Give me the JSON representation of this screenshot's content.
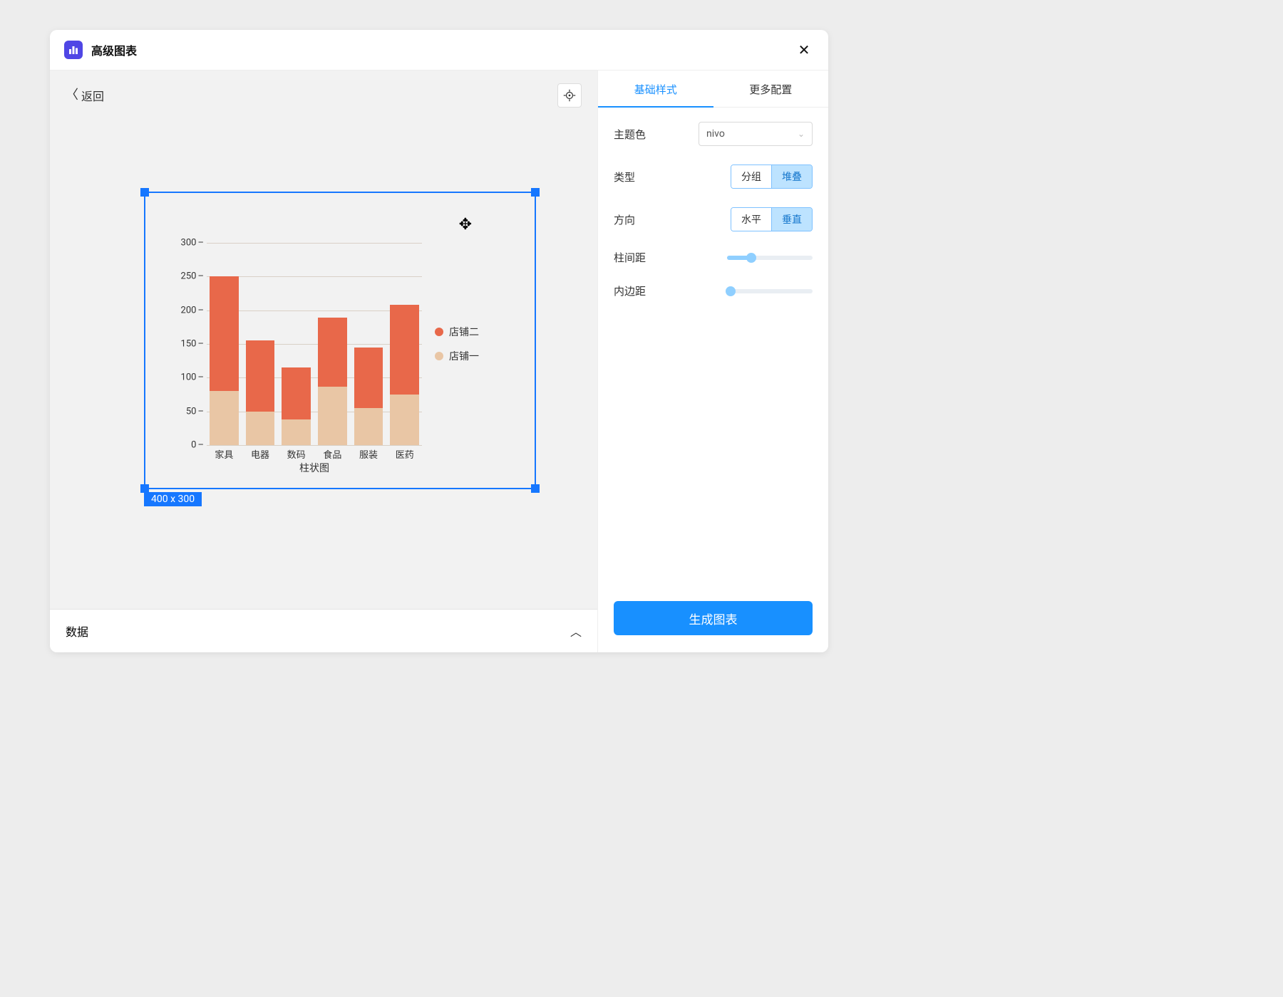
{
  "header": {
    "title": "高级图表",
    "close_label": "✕"
  },
  "canvas": {
    "back_label": "返回",
    "size_tag": "400 x 300"
  },
  "drawer": {
    "label": "数据"
  },
  "tabs": {
    "basic": "基础样式",
    "more": "更多配置"
  },
  "config": {
    "theme_label": "主题色",
    "theme_value": "nivo",
    "type_label": "类型",
    "type_options": {
      "group": "分组",
      "stack": "堆叠"
    },
    "type_selected": "stack",
    "direction_label": "方向",
    "direction_options": {
      "horizontal": "水平",
      "vertical": "垂直"
    },
    "direction_selected": "vertical",
    "gap_label": "柱间距",
    "gap_value_pct": 28,
    "padding_label": "内边距",
    "padding_value_pct": 4
  },
  "footer": {
    "generate_label": "生成图表"
  },
  "chart_data": {
    "type": "bar",
    "stacked": true,
    "orientation": "vertical",
    "title": "",
    "xlabel": "柱状图",
    "ylabel": "",
    "ylim": [
      0,
      300
    ],
    "yticks": [
      0,
      50,
      100,
      150,
      200,
      250,
      300
    ],
    "categories": [
      "家具",
      "电器",
      "数码",
      "食品",
      "服装",
      "医药"
    ],
    "series": [
      {
        "name": "店铺一",
        "color": "#e9c6a5",
        "values": [
          80,
          50,
          38,
          87,
          55,
          75
        ]
      },
      {
        "name": "店铺二",
        "color": "#e8684a",
        "values": [
          170,
          105,
          77,
          102,
          90,
          133
        ]
      }
    ],
    "legend_order": [
      "店铺二",
      "店铺一"
    ]
  }
}
